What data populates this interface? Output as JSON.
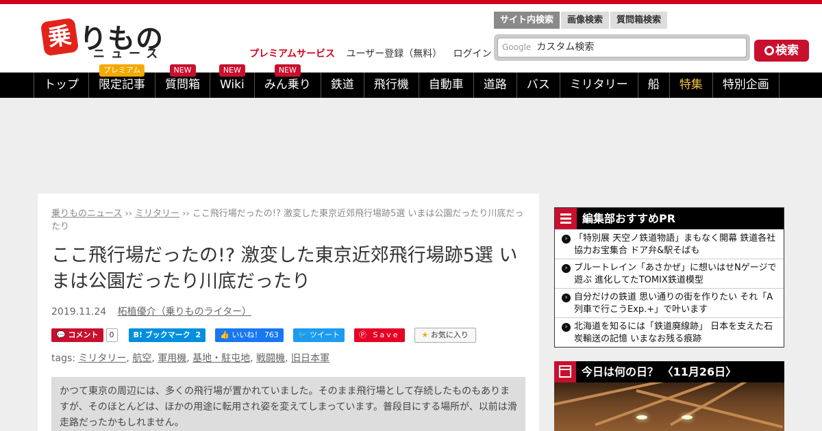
{
  "site": {
    "logo_mark": "乗",
    "logo_text": "りもの",
    "logo_sub": "ニュース"
  },
  "header_links": {
    "premium": "プレミアムサービス",
    "register": "ユーザー登録（無料）",
    "login": "ログイン"
  },
  "search": {
    "tabs": [
      "サイト内検索",
      "画像検索",
      "質問箱検索"
    ],
    "google_label": "Google",
    "placeholder": "カスタム検索",
    "button": "検索"
  },
  "nav": {
    "items": [
      {
        "label": "トップ"
      },
      {
        "label": "限定記事",
        "badge": "プレミアム"
      },
      {
        "label": "質問箱",
        "badge": "NEW"
      },
      {
        "label": "Wiki",
        "badge": "NEW"
      },
      {
        "label": "みん乗り",
        "badge": "NEW"
      },
      {
        "label": "鉄道"
      },
      {
        "label": "飛行機"
      },
      {
        "label": "自動車"
      },
      {
        "label": "道路"
      },
      {
        "label": "バス"
      },
      {
        "label": "ミリタリー"
      },
      {
        "label": "船"
      },
      {
        "label": "特集"
      },
      {
        "label": "特別企画"
      }
    ]
  },
  "article": {
    "breadcrumb": [
      "乗りものニュース",
      "ミリタリー",
      "ここ飛行場だったの!? 激変した東京近郊飛行場跡5選 いまは公園だったり川底だったり"
    ],
    "crumb_sep": "››",
    "title": "ここ飛行場だったの!? 激変した東京近郊飛行場跡5選 いまは公園だったり川底だったり",
    "date": "2019.11.24",
    "author": "柘植優介（乗りものライター）",
    "share": {
      "comment": "コメント",
      "comment_count": "0",
      "hatena": "B! ブックマーク",
      "hatena_count": "2",
      "facebook": "いいね！",
      "facebook_count": "763",
      "twitter": "ツイート",
      "pinterest": "Save",
      "favorite": "お気に入り"
    },
    "tags_label": "tags:",
    "tags": [
      "ミリタリー",
      "航空",
      "軍用機",
      "基地・駐屯地",
      "戦闘機",
      "旧日本軍"
    ],
    "lead": "かつて東京の周辺には、多くの飛行場が置かれていました。そのまま飛行場として存続したものもありますが、そのほとんどは、ほかの用途に転用され姿を変えてしまっています。普段目にする場所が、以前は滑走路だったかもしれません。"
  },
  "sidebar": {
    "pr_title": "編集部おすすめPR",
    "pr_items": [
      "「特別展 天空ノ鉄道物語」まもなく開幕 鉄道各社協力お宝集合 ドア弁&駅そばも",
      "ブルートレイン「あさかぜ」に想いはせNゲージで遊ぶ 進化してたTOMIX鉄道模型",
      "自分だけの鉄道 思い通りの街を作りたい それ「A列車で行こうExp.+」で叶います",
      "北海道を知るには「鉄道廃線跡」 日本を支えた石炭輸送の記憶 いまなお残る痕跡"
    ],
    "today_title": "今日は何の日？ 〈11月26日〉"
  },
  "colors": {
    "brand_red": "#d0021b",
    "nav_bg": "#000000",
    "feature_yellow": "#f5c242"
  }
}
